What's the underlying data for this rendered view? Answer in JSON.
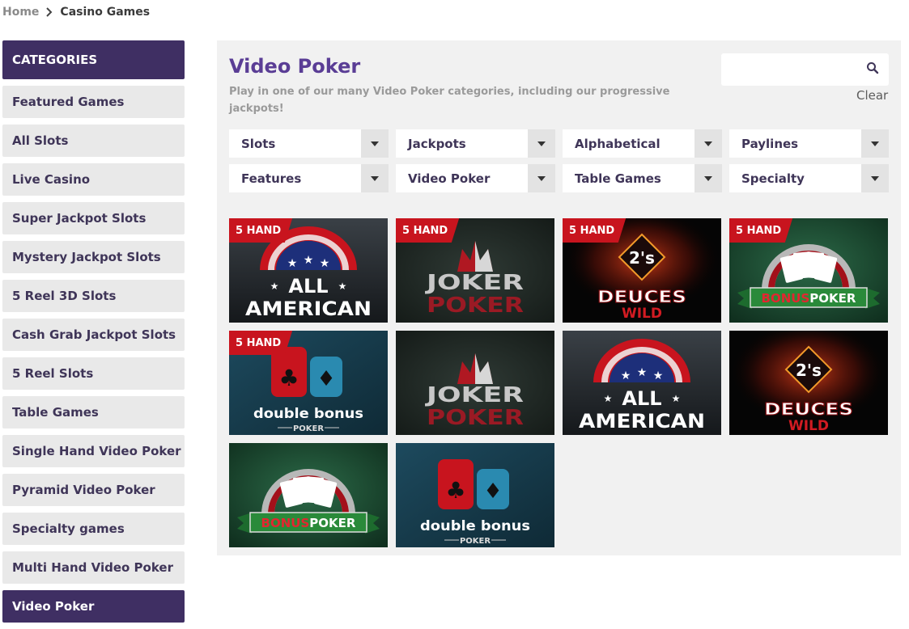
{
  "breadcrumb": {
    "home": "Home",
    "current": "Casino Games"
  },
  "sidebar": {
    "header": "CATEGORIES",
    "items": [
      {
        "label": "Featured Games",
        "active": false
      },
      {
        "label": "All Slots",
        "active": false
      },
      {
        "label": "Live Casino",
        "active": false
      },
      {
        "label": "Super Jackpot Slots",
        "active": false
      },
      {
        "label": "Mystery Jackpot Slots",
        "active": false
      },
      {
        "label": "5 Reel 3D Slots",
        "active": false
      },
      {
        "label": "Cash Grab Jackpot Slots",
        "active": false
      },
      {
        "label": "5 Reel Slots",
        "active": false
      },
      {
        "label": "Table Games",
        "active": false
      },
      {
        "label": "Single Hand Video Poker",
        "active": false
      },
      {
        "label": "Pyramid Video Poker",
        "active": false
      },
      {
        "label": "Specialty games",
        "active": false
      },
      {
        "label": "Multi Hand Video Poker",
        "active": false
      },
      {
        "label": "Video Poker",
        "active": true
      }
    ]
  },
  "main": {
    "title": "Video Poker",
    "subtitle": "Play in one of our many Video Poker categories, including our progressive jackpots!",
    "search": {
      "placeholder": "",
      "icon": "search-icon"
    },
    "clear": "Clear",
    "filters": [
      "Slots",
      "Jackpots",
      "Alphabetical",
      "Paylines",
      "Features",
      "Video Poker",
      "Table Games",
      "Specialty"
    ],
    "games": [
      {
        "theme": "all-american",
        "badge": "5 HAND",
        "line1": "ALL",
        "line2": "AMERICAN"
      },
      {
        "theme": "joker-poker",
        "badge": "5 HAND",
        "line1": "JOKER",
        "line2": "POKER"
      },
      {
        "theme": "deuces-wild",
        "badge": "5 HAND",
        "line1": "DEUCES",
        "line2": "WILD",
        "emblem": "2's"
      },
      {
        "theme": "bonus-poker",
        "badge": "5 HAND",
        "line1": "BONUS",
        "line2": "POKER"
      },
      {
        "theme": "double-bonus",
        "badge": "5 HAND",
        "line1": "double bonus",
        "line2": "POKER"
      },
      {
        "theme": "joker-poker",
        "badge": "",
        "line1": "JOKER",
        "line2": "POKER"
      },
      {
        "theme": "all-american",
        "badge": "",
        "line1": "ALL",
        "line2": "AMERICAN"
      },
      {
        "theme": "deuces-wild",
        "badge": "",
        "line1": "DEUCES",
        "line2": "WILD",
        "emblem": "2's"
      },
      {
        "theme": "bonus-poker",
        "badge": "",
        "line1": "BONUS",
        "line2": "POKER"
      },
      {
        "theme": "double-bonus",
        "badge": "",
        "line1": "double bonus",
        "line2": "POKER"
      }
    ]
  },
  "colors": {
    "brand": "#3f2f63",
    "title": "#5a3d95",
    "badge": "#c8141e",
    "panel": "#f1f1f1",
    "item": "#e9e9e9"
  }
}
